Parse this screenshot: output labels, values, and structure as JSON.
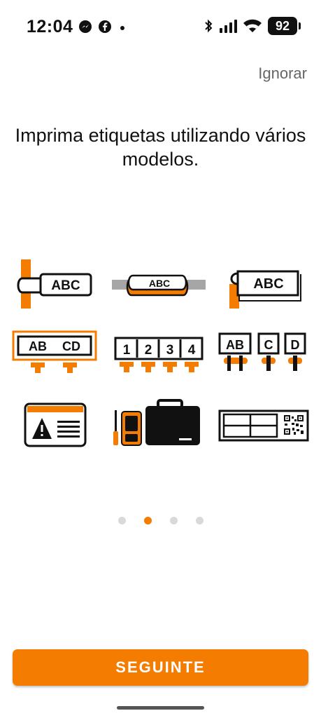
{
  "status_bar": {
    "time": "12:04",
    "battery": "92",
    "left_icons": [
      "messenger-icon",
      "facebook-icon",
      "notification-dot-icon"
    ],
    "right_icons": [
      "bluetooth-icon",
      "signal-icon",
      "wifi-icon",
      "battery-icon"
    ]
  },
  "skip_label": "Ignorar",
  "headline": "Imprima etiquetas utilizando vários modelos.",
  "templates": [
    {
      "icon": "wrap-label-icon",
      "text": "ABC"
    },
    {
      "icon": "sleeve-label-icon",
      "text": "ABC"
    },
    {
      "icon": "flag-label-icon",
      "text": "ABC"
    },
    {
      "icon": "terminal-block-2-icon",
      "cells": [
        "AB",
        "CD"
      ]
    },
    {
      "icon": "terminal-block-4-icon",
      "cells": [
        "1",
        "2",
        "3",
        "4"
      ]
    },
    {
      "icon": "terminal-block-3-icon",
      "cells": [
        "AB",
        "C",
        "D"
      ]
    },
    {
      "icon": "safety-warning-label-icon"
    },
    {
      "icon": "printer-and-case-icon"
    },
    {
      "icon": "patch-panel-qr-label-icon"
    }
  ],
  "pager": {
    "count": 4,
    "active": 1
  },
  "next_button_label": "SEGUINTE",
  "colors": {
    "accent": "#f47c00",
    "text": "#111111",
    "muted": "#666666",
    "dot_inactive": "#d9d9d9"
  }
}
